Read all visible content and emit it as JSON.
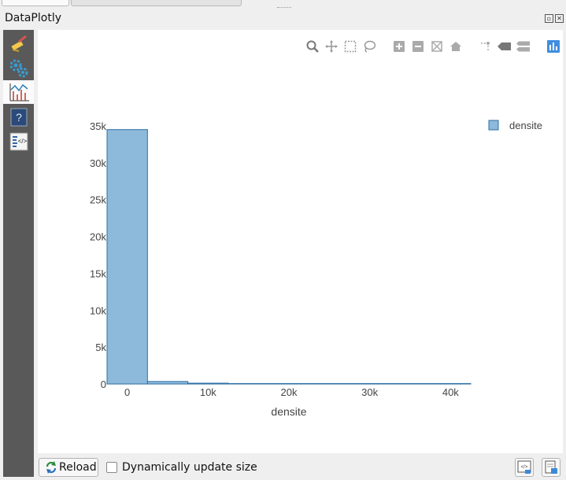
{
  "window": {
    "title": "DataPlotly"
  },
  "sidebar": {
    "items": [
      {
        "icon": "broom-icon"
      },
      {
        "icon": "gears-icon"
      },
      {
        "icon": "plot-icon",
        "active": true
      },
      {
        "icon": "help-icon"
      },
      {
        "icon": "code-icon"
      }
    ]
  },
  "modebar": {
    "icons": [
      "zoom-icon",
      "pan-icon",
      "box-select-icon",
      "lasso-select-icon",
      "zoom-in-icon",
      "zoom-out-icon",
      "autoscale-icon",
      "reset-axes-icon",
      "spike-lines-icon",
      "hover-closest-icon",
      "hover-compare-icon",
      "plotly-logo-icon"
    ]
  },
  "chart_data": {
    "type": "bar",
    "subtype": "histogram",
    "title": "",
    "xlabel": "densite",
    "ylabel": "",
    "xlim": [
      -2500,
      42500
    ],
    "ylim": [
      0,
      35000
    ],
    "x_ticks": [
      0,
      10000,
      20000,
      30000,
      40000
    ],
    "x_tick_labels": [
      "0",
      "10k",
      "20k",
      "30k",
      "40k"
    ],
    "y_ticks": [
      0,
      5000,
      10000,
      15000,
      20000,
      25000,
      30000,
      35000
    ],
    "y_tick_labels": [
      "0",
      "5k",
      "10k",
      "15k",
      "20k",
      "25k",
      "30k",
      "35k"
    ],
    "bin_width": 5000,
    "series": [
      {
        "name": "densite",
        "color": "#8db9da",
        "edge_color": "#2b6fa6",
        "bins": [
          {
            "x0": -2500,
            "x1": 2500,
            "value": 34500
          },
          {
            "x0": 2500,
            "x1": 7500,
            "value": 340
          },
          {
            "x0": 7500,
            "x1": 12500,
            "value": 110
          },
          {
            "x0": 12500,
            "x1": 17500,
            "value": 40
          },
          {
            "x0": 17500,
            "x1": 22500,
            "value": 20
          },
          {
            "x0": 22500,
            "x1": 27500,
            "value": 10
          },
          {
            "x0": 27500,
            "x1": 32500,
            "value": 5
          },
          {
            "x0": 32500,
            "x1": 37500,
            "value": 3
          },
          {
            "x0": 37500,
            "x1": 42500,
            "value": 2
          }
        ]
      }
    ],
    "legend": {
      "position": "top-right",
      "entries": [
        "densite"
      ]
    },
    "grid": false
  },
  "bottom": {
    "reload_label": "Reload",
    "dynamic_label": "Dynamically update size",
    "dynamic_checked": false
  }
}
